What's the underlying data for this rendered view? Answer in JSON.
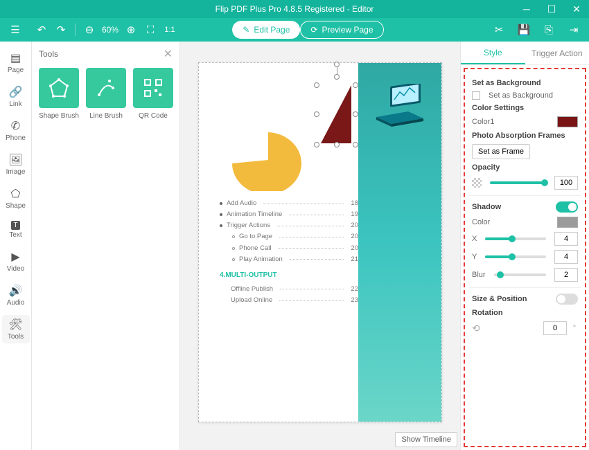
{
  "window": {
    "title": "Flip PDF Plus Pro 4.8.5 Registered - Editor"
  },
  "toolbar": {
    "zoom": "60%",
    "edit_label": "Edit Page",
    "preview_label": "Preview Page"
  },
  "leftnav": {
    "page": "Page",
    "link": "Link",
    "phone": "Phone",
    "image": "Image",
    "shape": "Shape",
    "text": "Text",
    "video": "Video",
    "audio": "Audio",
    "tools": "Tools"
  },
  "tools_panel": {
    "title": "Tools",
    "shape_brush": "Shape Brush",
    "line_brush": "Line Brush",
    "qr_code": "QR Code"
  },
  "canvas": {
    "toc_section": "4.MULTI-OUTPUT",
    "toc": [
      {
        "label": "Add Audio",
        "page": "18",
        "level": 0,
        "filled": true
      },
      {
        "label": "Animation Timeline",
        "page": "19",
        "level": 0,
        "filled": true
      },
      {
        "label": "Trigger Actions",
        "page": "20",
        "level": 0,
        "filled": true
      },
      {
        "label": "Go to Page",
        "page": "20",
        "level": 1,
        "filled": false
      },
      {
        "label": "Phone Call",
        "page": "20",
        "level": 1,
        "filled": false
      },
      {
        "label": "Play Animation",
        "page": "21",
        "level": 1,
        "filled": false
      }
    ],
    "toc2": [
      {
        "label": "Offline Publish",
        "page": "22"
      },
      {
        "label": "Upload Online",
        "page": "23"
      }
    ],
    "show_timeline": "Show Timeline"
  },
  "props": {
    "tab_style": "Style",
    "tab_trigger": "Trigger Action",
    "set_bg_title": "Set as Background",
    "set_bg_check": "Set as Background",
    "color_settings": "Color Settings",
    "color1": "Color1",
    "absorption": "Photo Absorption Frames",
    "set_frame": "Set as Frame",
    "opacity": "Opacity",
    "opacity_val": "100",
    "shadow": "Shadow",
    "shadow_color": "Color",
    "x": "X",
    "x_val": "4",
    "y": "Y",
    "y_val": "4",
    "blur": "Blur",
    "blur_val": "2",
    "size_pos": "Size & Position",
    "rotation": "Rotation",
    "rotation_val": "0"
  },
  "colors": {
    "accent": "#1fc1a6",
    "shape_fill": "#7a1818",
    "pie": "#f3bb3e"
  }
}
